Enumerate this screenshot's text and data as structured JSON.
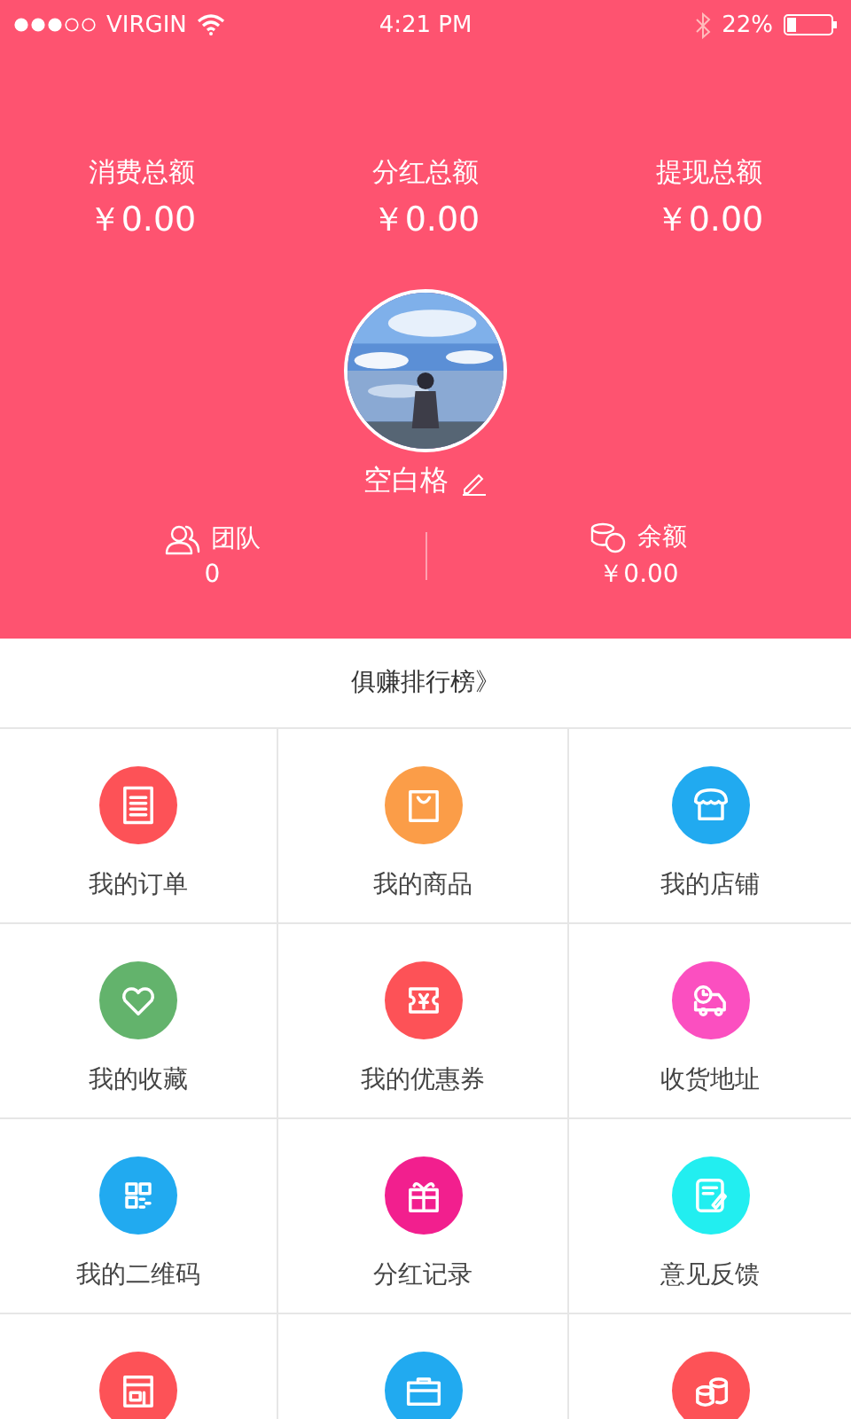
{
  "status_bar": {
    "carrier": "VIRGIN",
    "time": "4:21 PM",
    "battery": "22%"
  },
  "totals": [
    {
      "label": "消费总额",
      "value": "￥0.00"
    },
    {
      "label": "分红总额",
      "value": "￥0.00"
    },
    {
      "label": "提现总额",
      "value": "￥0.00"
    }
  ],
  "profile": {
    "name": "空白格"
  },
  "stats": [
    {
      "kind": "team",
      "label": "团队",
      "value": "0"
    },
    {
      "kind": "balance",
      "label": "余额",
      "value": "￥0.00"
    }
  ],
  "ranking_link": "俱赚排行榜》",
  "menu": [
    {
      "kind": "receipt",
      "label": "我的订单",
      "color": "#fd5257"
    },
    {
      "kind": "bag",
      "label": "我的商品",
      "color": "#fb9d48"
    },
    {
      "kind": "store",
      "label": "我的店铺",
      "color": "#21aaf0"
    },
    {
      "kind": "heart",
      "label": "我的收藏",
      "color": "#63b36c"
    },
    {
      "kind": "coupon",
      "label": "我的优惠券",
      "color": "#fd5257"
    },
    {
      "kind": "truck",
      "label": "收货地址",
      "color": "#fb4fc0"
    },
    {
      "kind": "qr",
      "label": "我的二维码",
      "color": "#21aaf0"
    },
    {
      "kind": "gift",
      "label": "分红记录",
      "color": "#f21f8e"
    },
    {
      "kind": "note",
      "label": "意见反馈",
      "color": "#22eef0"
    },
    {
      "kind": "shop",
      "color": "#fd5257"
    },
    {
      "kind": "briefcase",
      "color": "#21aaf0"
    },
    {
      "kind": "coins",
      "color": "#fd5257"
    }
  ]
}
